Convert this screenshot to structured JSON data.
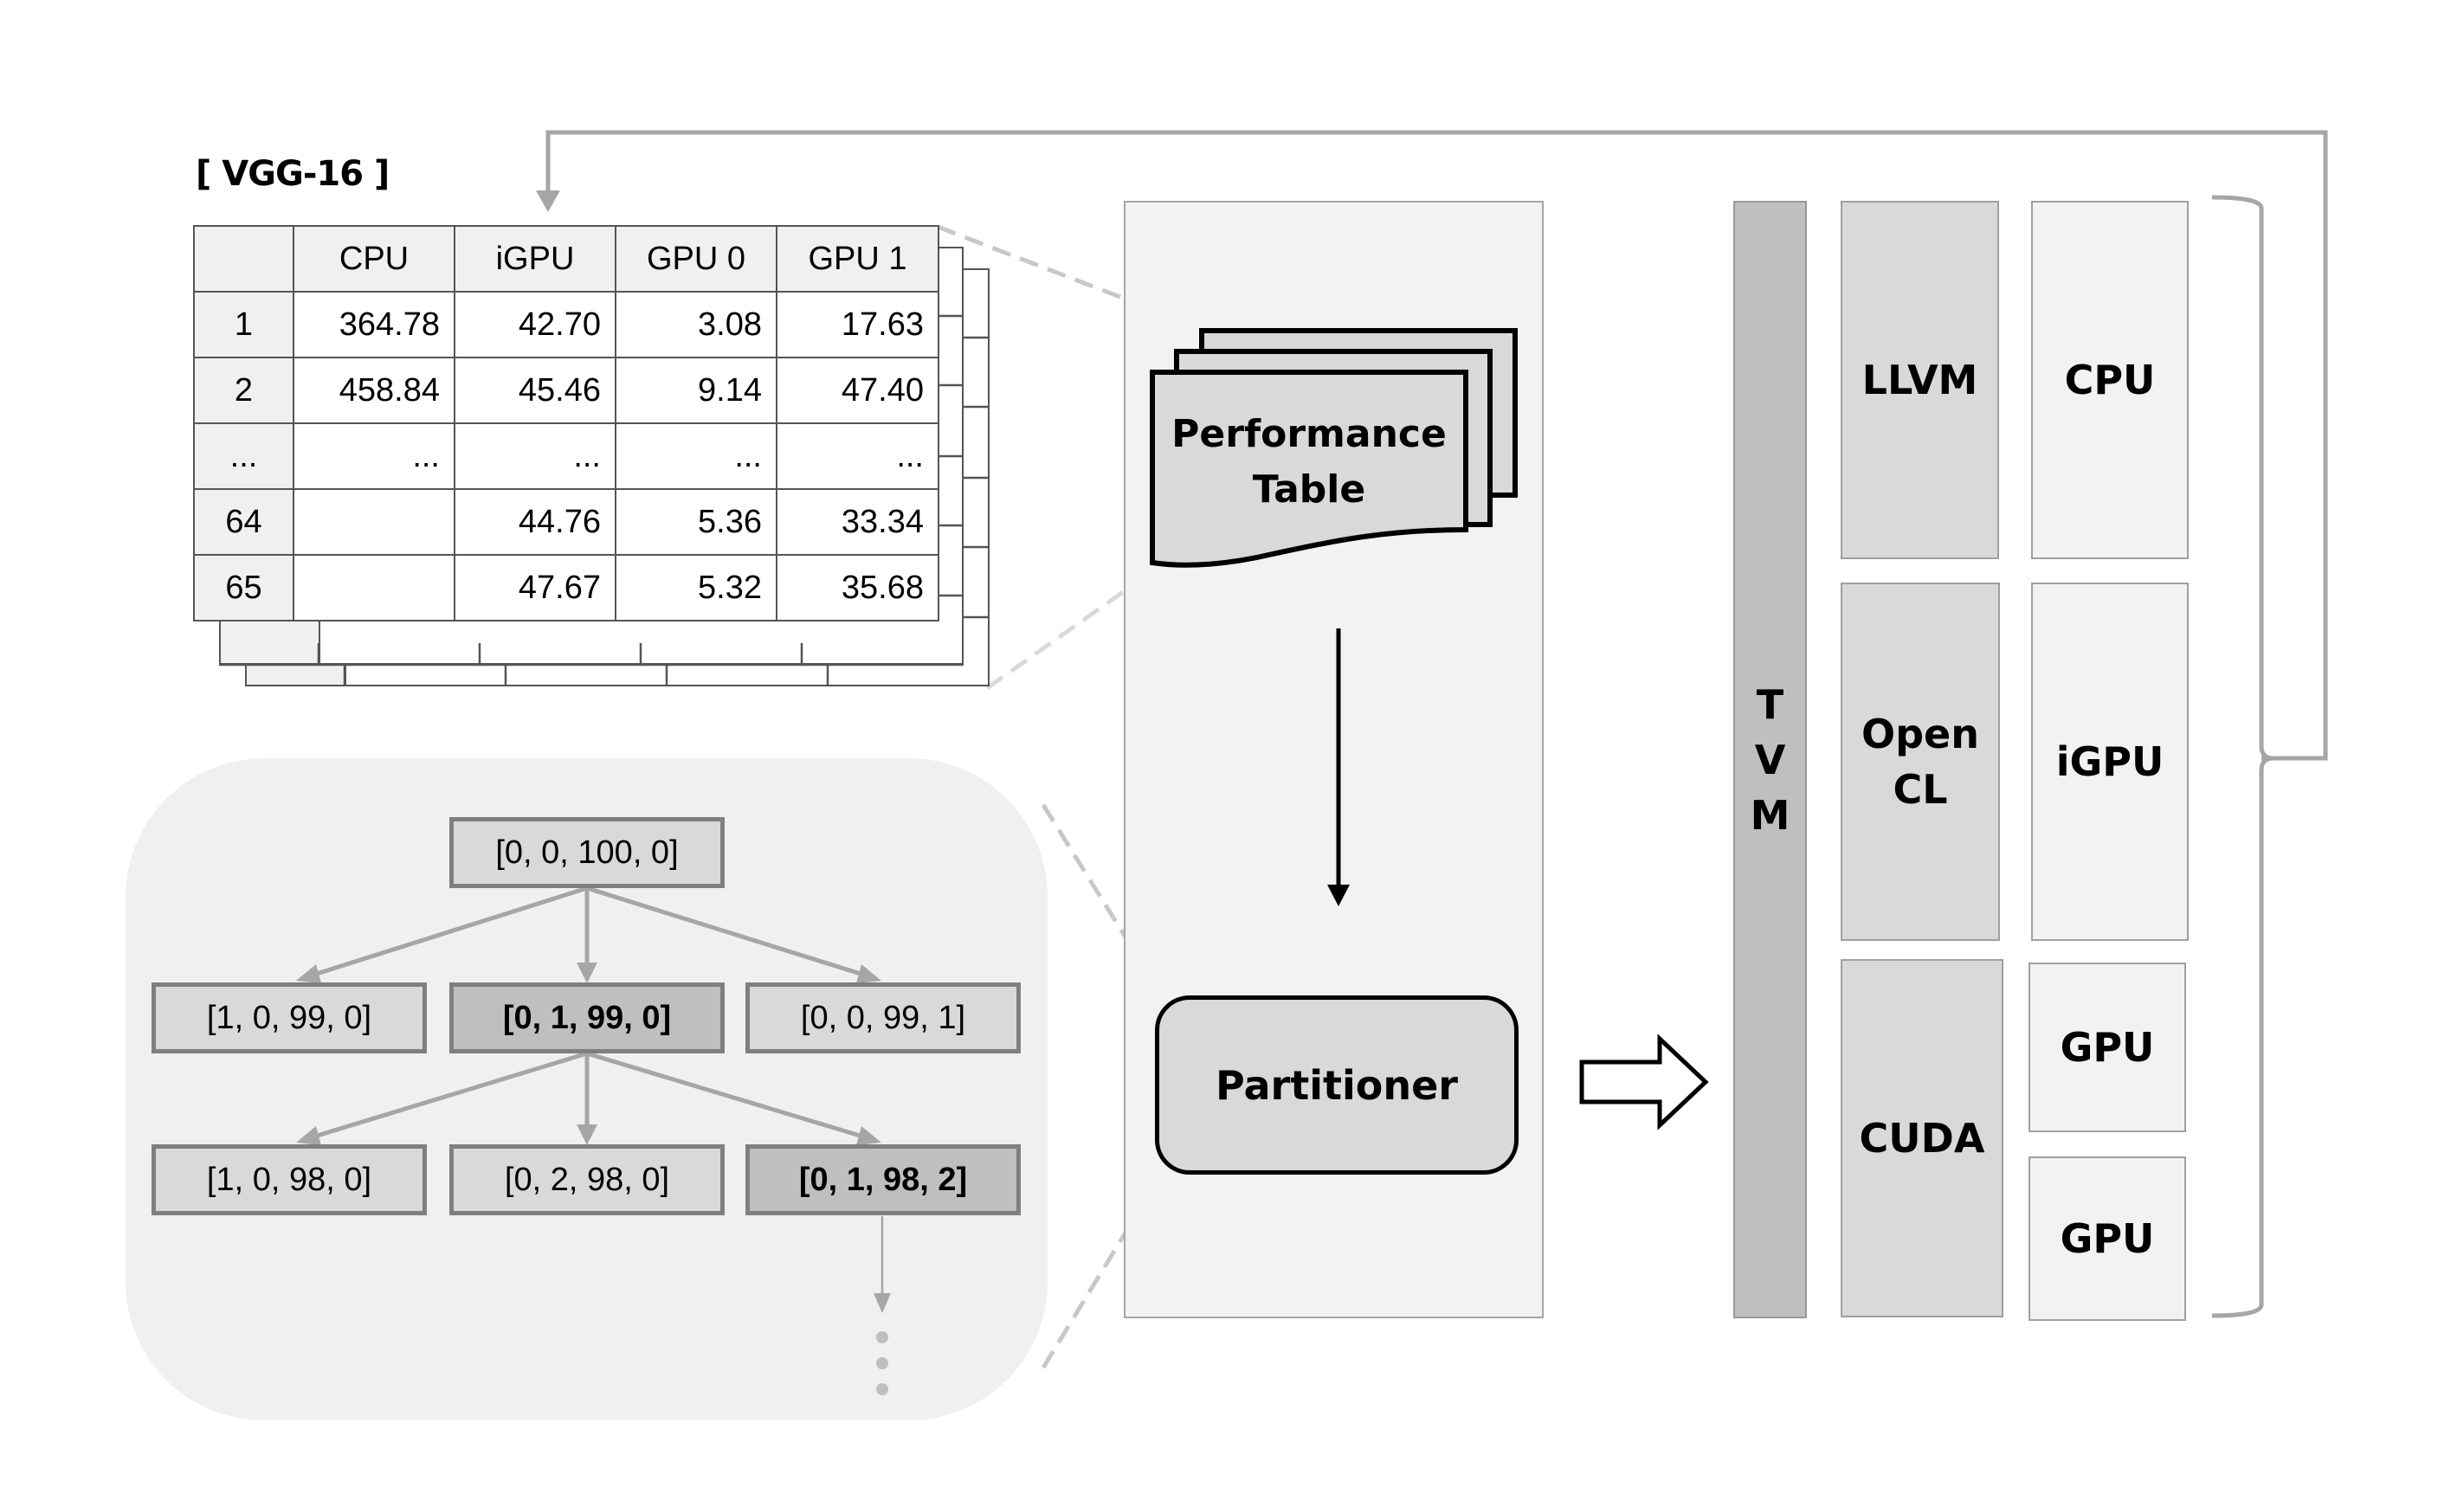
{
  "table": {
    "title": "[ VGG-16 ]",
    "columns": [
      "",
      "CPU",
      "iGPU",
      "GPU 0",
      "GPU 1"
    ],
    "rows": [
      [
        "1",
        "364.78",
        "42.70",
        "3.08",
        "17.63"
      ],
      [
        "2",
        "458.84",
        "45.46",
        "9.14",
        "47.40"
      ],
      [
        "...",
        "...",
        "...",
        "...",
        "..."
      ],
      [
        "64",
        "",
        "44.76",
        "5.36",
        "33.34"
      ],
      [
        "65",
        "",
        "47.67",
        "5.32",
        "35.68"
      ]
    ]
  },
  "tree": {
    "root": "[0, 0, 100, 0]",
    "level1": [
      {
        "label": "[1, 0, 99, 0]",
        "selected": false
      },
      {
        "label": "[0, 1, 99, 0]",
        "selected": true
      },
      {
        "label": "[0, 0, 99, 1]",
        "selected": false
      }
    ],
    "level2": [
      {
        "label": "[1, 0, 98, 0]",
        "selected": false
      },
      {
        "label": "[0, 2, 98, 0]",
        "selected": false
      },
      {
        "label": "[0, 1, 98, 2]",
        "selected": true
      }
    ]
  },
  "pipeline": {
    "performance_table": [
      "Performance",
      "Table"
    ],
    "partitioner": "Partitioner"
  },
  "runtime": {
    "tvm": [
      "T",
      "V",
      "M"
    ],
    "backends": [
      {
        "lines": [
          "LLVM"
        ]
      },
      {
        "lines": [
          "Open",
          "CL"
        ]
      },
      {
        "lines": [
          "CUDA"
        ]
      }
    ],
    "devices": [
      "CPU",
      "iGPU",
      "GPU",
      "GPU"
    ]
  },
  "colors": {
    "connector_gray": "#a6a6a6",
    "panel_bg": "#f0f0f0",
    "node_fill": "#d9d9d9",
    "node_selected_fill": "#bfbfbf",
    "tvm_fill": "#bfbfbf"
  }
}
